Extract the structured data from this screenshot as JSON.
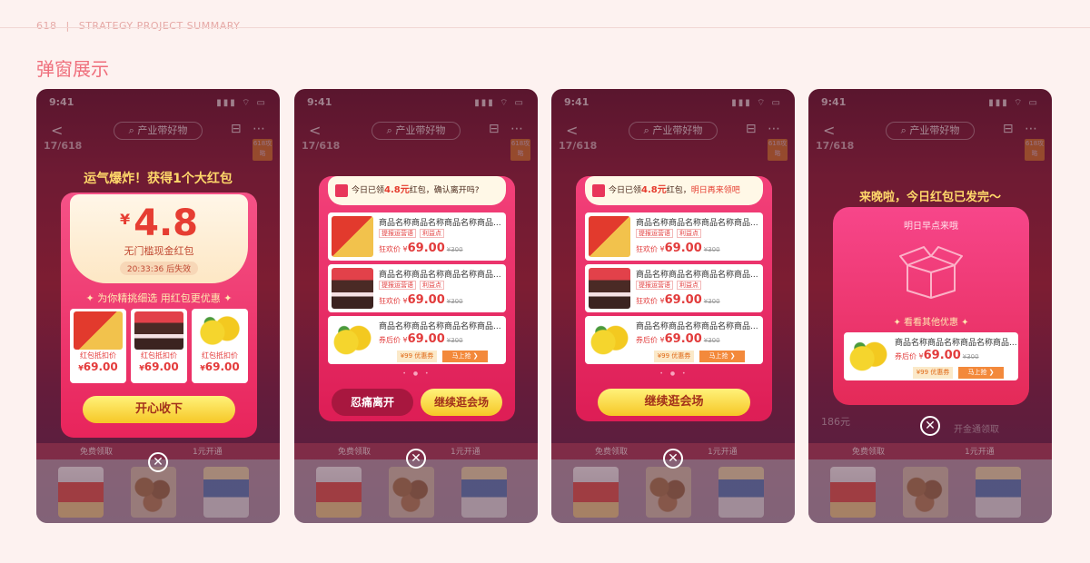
{
  "header": {
    "page_num": "618",
    "separator": "|",
    "project": "STRATEGY PROJECT SUMMARY"
  },
  "section_title": "弹窗展示",
  "phone_common": {
    "time": "9:41",
    "search": "产业带好物",
    "logo": "17/618",
    "badge": "618攻略",
    "bottom_left": "免费领取",
    "bottom_right": "1元开通",
    "status_icons": "▮▮▮ ⌔ ▭",
    "nav_icons": "⊟ ⋯",
    "back": "<"
  },
  "phone1": {
    "headline": "运气爆炸！获得1个大红包",
    "currency": "¥",
    "amount": "4.8",
    "subtitle": "无门槛现金红包",
    "timer": "20:33:36 后失效",
    "section": "为你精挑细选 用红包更优惠",
    "tiles": [
      {
        "label": "红包抵扣价",
        "price": "69.00",
        "cur": "¥",
        "img": "box"
      },
      {
        "label": "红包抵扣价",
        "price": "69.00",
        "cur": "¥",
        "img": "cake"
      },
      {
        "label": "红包抵扣价",
        "price": "69.00",
        "cur": "¥",
        "img": "lemon"
      }
    ],
    "button": "开心收下"
  },
  "phone2": {
    "banner_pre": "今日已领",
    "banner_amt": "4.8元",
    "banner_post": "红包，确认离开吗?",
    "items": [
      {
        "name": "商品名称商品名称商品名称商品...",
        "tag1": "提报运营语",
        "tag2": "利益点",
        "price_label": "狂欢价",
        "cur": "¥",
        "price": "69.00",
        "orig": "¥300",
        "img": "box"
      },
      {
        "name": "商品名称商品名称商品名称商品...",
        "tag1": "提报运营语",
        "tag2": "利益点",
        "price_label": "狂欢价",
        "cur": "¥",
        "price": "69.00",
        "orig": "¥300",
        "img": "cake"
      },
      {
        "name": "商品名称商品名称商品名称商品...",
        "price_label": "券后价",
        "cur": "¥",
        "price": "69.00",
        "orig": "¥300",
        "coupon": "¥99 优惠券",
        "buy": "马上抢 ❯",
        "img": "lemon"
      }
    ],
    "dots": "• ● •",
    "btn_leave": "忍痛离开",
    "btn_stay": "继续逛会场"
  },
  "phone3": {
    "banner_pre": "今日已领",
    "banner_amt": "4.8元",
    "banner_mid": "红包，",
    "banner_hl": "明日再来领吧",
    "items": [
      {
        "name": "商品名称商品名称商品名称商品...",
        "tag1": "提报运营语",
        "tag2": "利益点",
        "price_label": "狂欢价",
        "cur": "¥",
        "price": "69.00",
        "orig": "¥300",
        "img": "box"
      },
      {
        "name": "商品名称商品名称商品名称商品...",
        "tag1": "提报运营语",
        "tag2": "利益点",
        "price_label": "狂欢价",
        "cur": "¥",
        "price": "69.00",
        "orig": "¥300",
        "img": "cake"
      },
      {
        "name": "商品名称商品名称商品名称商品...",
        "price_label": "券后价",
        "cur": "¥",
        "price": "69.00",
        "orig": "¥300",
        "coupon": "¥99 优惠券",
        "buy": "马上抢 ❯",
        "img": "lemon"
      }
    ],
    "dots": "• ● •",
    "btn_stay": "继续逛会场"
  },
  "phone4": {
    "headline": "来晚啦，今日红包已发完～",
    "tomorrow": "明日早点来哦",
    "more": "看看其他优惠",
    "item": {
      "name": "商品名称商品名称商品名称商品...",
      "price_label": "券后价",
      "cur": "¥",
      "price": "69.00",
      "orig": "¥300",
      "coupon": "¥99 优惠券",
      "buy": "马上抢 ❯"
    },
    "bg_left": "186元",
    "bg_right": "开金通领取"
  },
  "close_icon": "✕"
}
